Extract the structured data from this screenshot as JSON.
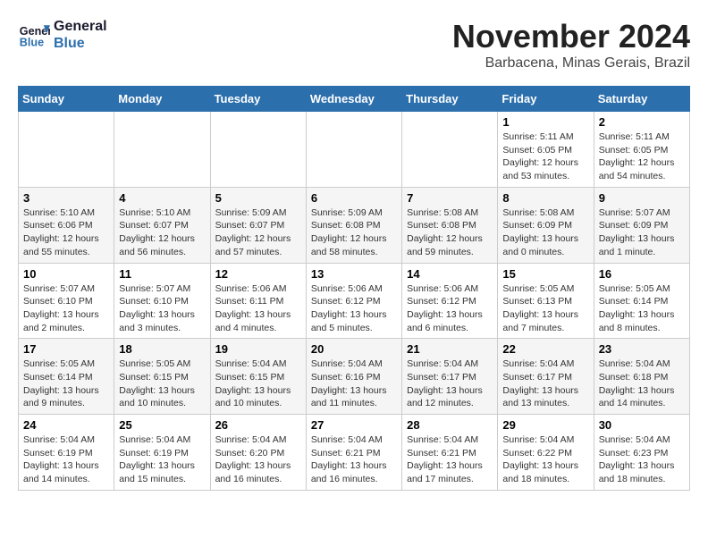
{
  "header": {
    "logo_line1": "General",
    "logo_line2": "Blue",
    "month_title": "November 2024",
    "location": "Barbacena, Minas Gerais, Brazil"
  },
  "weekdays": [
    "Sunday",
    "Monday",
    "Tuesday",
    "Wednesday",
    "Thursday",
    "Friday",
    "Saturday"
  ],
  "weeks": [
    [
      {
        "day": "",
        "detail": ""
      },
      {
        "day": "",
        "detail": ""
      },
      {
        "day": "",
        "detail": ""
      },
      {
        "day": "",
        "detail": ""
      },
      {
        "day": "",
        "detail": ""
      },
      {
        "day": "1",
        "detail": "Sunrise: 5:11 AM\nSunset: 6:05 PM\nDaylight: 12 hours\nand 53 minutes."
      },
      {
        "day": "2",
        "detail": "Sunrise: 5:11 AM\nSunset: 6:05 PM\nDaylight: 12 hours\nand 54 minutes."
      }
    ],
    [
      {
        "day": "3",
        "detail": "Sunrise: 5:10 AM\nSunset: 6:06 PM\nDaylight: 12 hours\nand 55 minutes."
      },
      {
        "day": "4",
        "detail": "Sunrise: 5:10 AM\nSunset: 6:07 PM\nDaylight: 12 hours\nand 56 minutes."
      },
      {
        "day": "5",
        "detail": "Sunrise: 5:09 AM\nSunset: 6:07 PM\nDaylight: 12 hours\nand 57 minutes."
      },
      {
        "day": "6",
        "detail": "Sunrise: 5:09 AM\nSunset: 6:08 PM\nDaylight: 12 hours\nand 58 minutes."
      },
      {
        "day": "7",
        "detail": "Sunrise: 5:08 AM\nSunset: 6:08 PM\nDaylight: 12 hours\nand 59 minutes."
      },
      {
        "day": "8",
        "detail": "Sunrise: 5:08 AM\nSunset: 6:09 PM\nDaylight: 13 hours\nand 0 minutes."
      },
      {
        "day": "9",
        "detail": "Sunrise: 5:07 AM\nSunset: 6:09 PM\nDaylight: 13 hours\nand 1 minute."
      }
    ],
    [
      {
        "day": "10",
        "detail": "Sunrise: 5:07 AM\nSunset: 6:10 PM\nDaylight: 13 hours\nand 2 minutes."
      },
      {
        "day": "11",
        "detail": "Sunrise: 5:07 AM\nSunset: 6:10 PM\nDaylight: 13 hours\nand 3 minutes."
      },
      {
        "day": "12",
        "detail": "Sunrise: 5:06 AM\nSunset: 6:11 PM\nDaylight: 13 hours\nand 4 minutes."
      },
      {
        "day": "13",
        "detail": "Sunrise: 5:06 AM\nSunset: 6:12 PM\nDaylight: 13 hours\nand 5 minutes."
      },
      {
        "day": "14",
        "detail": "Sunrise: 5:06 AM\nSunset: 6:12 PM\nDaylight: 13 hours\nand 6 minutes."
      },
      {
        "day": "15",
        "detail": "Sunrise: 5:05 AM\nSunset: 6:13 PM\nDaylight: 13 hours\nand 7 minutes."
      },
      {
        "day": "16",
        "detail": "Sunrise: 5:05 AM\nSunset: 6:14 PM\nDaylight: 13 hours\nand 8 minutes."
      }
    ],
    [
      {
        "day": "17",
        "detail": "Sunrise: 5:05 AM\nSunset: 6:14 PM\nDaylight: 13 hours\nand 9 minutes."
      },
      {
        "day": "18",
        "detail": "Sunrise: 5:05 AM\nSunset: 6:15 PM\nDaylight: 13 hours\nand 10 minutes."
      },
      {
        "day": "19",
        "detail": "Sunrise: 5:04 AM\nSunset: 6:15 PM\nDaylight: 13 hours\nand 10 minutes."
      },
      {
        "day": "20",
        "detail": "Sunrise: 5:04 AM\nSunset: 6:16 PM\nDaylight: 13 hours\nand 11 minutes."
      },
      {
        "day": "21",
        "detail": "Sunrise: 5:04 AM\nSunset: 6:17 PM\nDaylight: 13 hours\nand 12 minutes."
      },
      {
        "day": "22",
        "detail": "Sunrise: 5:04 AM\nSunset: 6:17 PM\nDaylight: 13 hours\nand 13 minutes."
      },
      {
        "day": "23",
        "detail": "Sunrise: 5:04 AM\nSunset: 6:18 PM\nDaylight: 13 hours\nand 14 minutes."
      }
    ],
    [
      {
        "day": "24",
        "detail": "Sunrise: 5:04 AM\nSunset: 6:19 PM\nDaylight: 13 hours\nand 14 minutes."
      },
      {
        "day": "25",
        "detail": "Sunrise: 5:04 AM\nSunset: 6:19 PM\nDaylight: 13 hours\nand 15 minutes."
      },
      {
        "day": "26",
        "detail": "Sunrise: 5:04 AM\nSunset: 6:20 PM\nDaylight: 13 hours\nand 16 minutes."
      },
      {
        "day": "27",
        "detail": "Sunrise: 5:04 AM\nSunset: 6:21 PM\nDaylight: 13 hours\nand 16 minutes."
      },
      {
        "day": "28",
        "detail": "Sunrise: 5:04 AM\nSunset: 6:21 PM\nDaylight: 13 hours\nand 17 minutes."
      },
      {
        "day": "29",
        "detail": "Sunrise: 5:04 AM\nSunset: 6:22 PM\nDaylight: 13 hours\nand 18 minutes."
      },
      {
        "day": "30",
        "detail": "Sunrise: 5:04 AM\nSunset: 6:23 PM\nDaylight: 13 hours\nand 18 minutes."
      }
    ]
  ]
}
